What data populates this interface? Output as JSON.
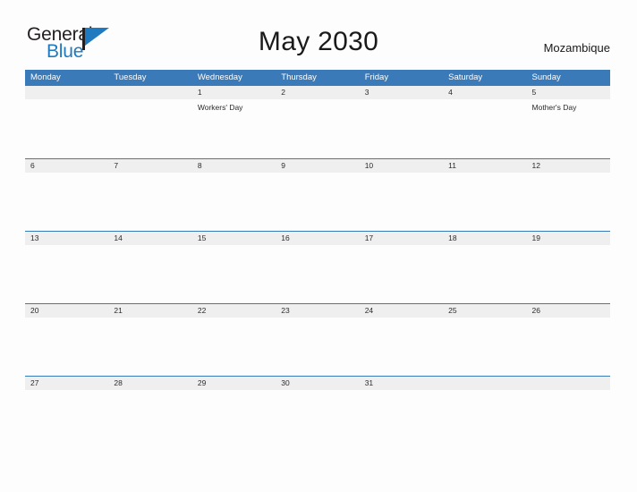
{
  "brand": {
    "name_part1": "General",
    "name_part2": "Blue",
    "logo_icon": "general-blue-triangle-logo",
    "accent_color": "#1f7ac0",
    "text_color": "#231f20"
  },
  "header": {
    "title": "May 2030",
    "country": "Mozambique"
  },
  "colors": {
    "header_blue": "#3a7ab8",
    "row_band_gray": "#efefef",
    "page_background": "#fdfdfd",
    "text": "#2b2b2b"
  },
  "calendar": {
    "month": "May",
    "year": "2030",
    "weekday_headers": [
      "Monday",
      "Tuesday",
      "Wednesday",
      "Thursday",
      "Friday",
      "Saturday",
      "Sunday"
    ],
    "weeks": [
      {
        "days": [
          {
            "number": "",
            "events": []
          },
          {
            "number": "",
            "events": []
          },
          {
            "number": "1",
            "events": [
              "Workers' Day"
            ]
          },
          {
            "number": "2",
            "events": []
          },
          {
            "number": "3",
            "events": []
          },
          {
            "number": "4",
            "events": []
          },
          {
            "number": "5",
            "events": [
              "Mother's Day"
            ]
          }
        ]
      },
      {
        "days": [
          {
            "number": "6",
            "events": []
          },
          {
            "number": "7",
            "events": []
          },
          {
            "number": "8",
            "events": []
          },
          {
            "number": "9",
            "events": []
          },
          {
            "number": "10",
            "events": []
          },
          {
            "number": "11",
            "events": []
          },
          {
            "number": "12",
            "events": []
          }
        ]
      },
      {
        "days": [
          {
            "number": "13",
            "events": []
          },
          {
            "number": "14",
            "events": []
          },
          {
            "number": "15",
            "events": []
          },
          {
            "number": "16",
            "events": []
          },
          {
            "number": "17",
            "events": []
          },
          {
            "number": "18",
            "events": []
          },
          {
            "number": "19",
            "events": []
          }
        ]
      },
      {
        "days": [
          {
            "number": "20",
            "events": []
          },
          {
            "number": "21",
            "events": []
          },
          {
            "number": "22",
            "events": []
          },
          {
            "number": "23",
            "events": []
          },
          {
            "number": "24",
            "events": []
          },
          {
            "number": "25",
            "events": []
          },
          {
            "number": "26",
            "events": []
          }
        ]
      },
      {
        "days": [
          {
            "number": "27",
            "events": []
          },
          {
            "number": "28",
            "events": []
          },
          {
            "number": "29",
            "events": []
          },
          {
            "number": "30",
            "events": []
          },
          {
            "number": "31",
            "events": []
          },
          {
            "number": "",
            "events": []
          },
          {
            "number": "",
            "events": []
          }
        ]
      }
    ]
  }
}
